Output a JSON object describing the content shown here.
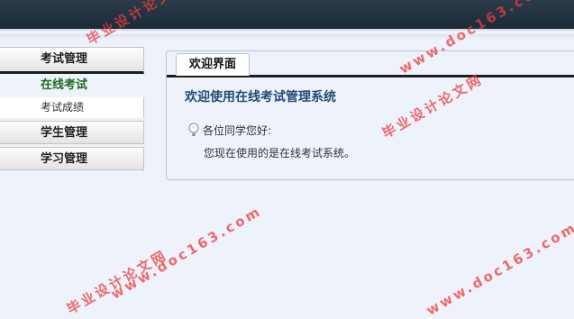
{
  "menu": {
    "groups": [
      {
        "label": "考试管理",
        "items": [
          {
            "label": "在线考试",
            "active": true
          },
          {
            "label": "考试成绩",
            "active": false
          }
        ]
      },
      {
        "label": "学生管理",
        "items": []
      },
      {
        "label": "学习管理",
        "items": []
      }
    ]
  },
  "panel": {
    "tab_label": "欢迎界面",
    "title": "欢迎使用在线考试管理系统",
    "greeting": "各位同学您好:",
    "description": "您现在使用的是在线考试系统。"
  },
  "watermark": {
    "text_cn": "毕业设计论文网",
    "text_en": "www.doc163.com"
  },
  "colors": {
    "header": "#223240",
    "background": "#eef2fa",
    "title": "#254a7a",
    "active_item": "#1d6d1d",
    "watermark": "#eb3c3c"
  },
  "icons": [
    "lightbulb-icon"
  ]
}
